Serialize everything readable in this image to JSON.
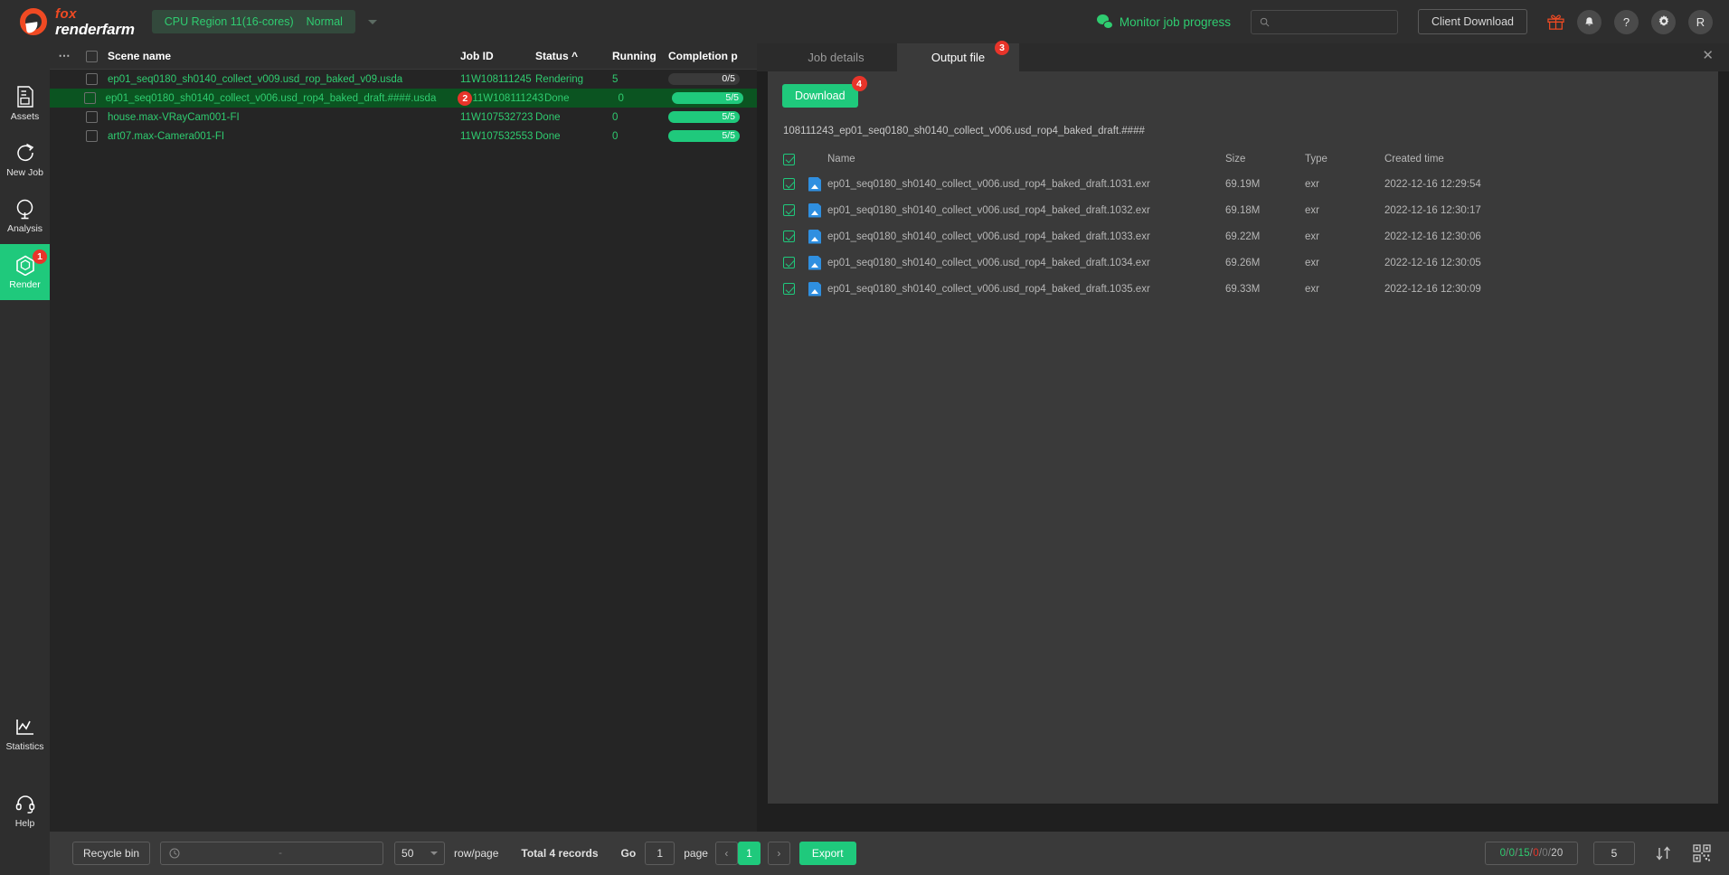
{
  "header": {
    "logo_fox": "fox",
    "logo_renderfarm": "renderfarm",
    "region_label": "CPU Region 11(16-cores)",
    "region_status": "Normal",
    "monitor_label": "Monitor job progress",
    "search_placeholder": "",
    "search_value": "",
    "client_download_label": "Client Download",
    "avatar_initial": "R",
    "help_glyph": "?"
  },
  "sidebar": {
    "items": [
      {
        "label": "Assets",
        "icon": "file-list-icon",
        "badge": ""
      },
      {
        "label": "New Job",
        "icon": "new-job-icon",
        "badge": ""
      },
      {
        "label": "Analysis",
        "icon": "analysis-icon",
        "badge": ""
      },
      {
        "label": "Render",
        "icon": "render-icon",
        "badge": "1"
      },
      {
        "label": "Statistics",
        "icon": "statistics-icon",
        "badge": ""
      },
      {
        "label": "Help",
        "icon": "headset-icon",
        "badge": ""
      }
    ]
  },
  "jobs": {
    "columns": {
      "scene_name": "Scene name",
      "job_id": "Job ID",
      "status": "Status",
      "running": "Running",
      "completion": "Completion p"
    },
    "rows": [
      {
        "scene_name": "ep01_seq0180_sh0140_collect_v009.usd_rop_baked_v09.usda",
        "job_id": "11W108111245",
        "status": "Rendering",
        "running": "5",
        "progress_text": "0/5",
        "progress_percent": 0,
        "badge": "",
        "selected": false
      },
      {
        "scene_name": "ep01_seq0180_sh0140_collect_v006.usd_rop4_baked_draft.####.usda",
        "job_id": "11W108111243",
        "status": "Done",
        "running": "0",
        "progress_text": "5/5",
        "progress_percent": 100,
        "badge": "2",
        "selected": true
      },
      {
        "scene_name": "house.max-VRayCam001-FI",
        "job_id": "11W107532723",
        "status": "Done",
        "running": "0",
        "progress_text": "5/5",
        "progress_percent": 100,
        "badge": "",
        "selected": false
      },
      {
        "scene_name": "art07.max-Camera001-FI",
        "job_id": "11W107532553",
        "status": "Done",
        "running": "0",
        "progress_text": "5/5",
        "progress_percent": 100,
        "badge": "",
        "selected": false
      }
    ]
  },
  "right_panel": {
    "tabs": [
      {
        "label": "Job details",
        "badge": "",
        "active": false
      },
      {
        "label": "Output file",
        "badge": "3",
        "active": true
      }
    ],
    "close_glyph": "✕",
    "download_label": "Download",
    "download_badge": "4",
    "file_path": "108111243_ep01_seq0180_sh0140_collect_v006.usd_rop4_baked_draft.####",
    "file_columns": {
      "name": "Name",
      "size": "Size",
      "type": "Type",
      "created": "Created time"
    },
    "files": [
      {
        "name": "ep01_seq0180_sh0140_collect_v006.usd_rop4_baked_draft.1031.exr",
        "size": "69.19M",
        "type": "exr",
        "created": "2022-12-16 12:29:54"
      },
      {
        "name": "ep01_seq0180_sh0140_collect_v006.usd_rop4_baked_draft.1032.exr",
        "size": "69.18M",
        "type": "exr",
        "created": "2022-12-16 12:30:17"
      },
      {
        "name": "ep01_seq0180_sh0140_collect_v006.usd_rop4_baked_draft.1033.exr",
        "size": "69.22M",
        "type": "exr",
        "created": "2022-12-16 12:30:06"
      },
      {
        "name": "ep01_seq0180_sh0140_collect_v006.usd_rop4_baked_draft.1034.exr",
        "size": "69.26M",
        "type": "exr",
        "created": "2022-12-16 12:30:05"
      },
      {
        "name": "ep01_seq0180_sh0140_collect_v006.usd_rop4_baked_draft.1035.exr",
        "size": "69.33M",
        "type": "exr",
        "created": "2022-12-16 12:30:09"
      }
    ]
  },
  "bottom_bar": {
    "recycle_bin_label": "Recycle bin",
    "search_value": "",
    "search_placeholder": "-",
    "rows_per_page": "50",
    "rows_per_page_label": "row/page",
    "total_records_label": "Total 4 records",
    "go_label": "Go",
    "page_value": "1",
    "page_label": "page",
    "prev_glyph": "‹",
    "current_page": "1",
    "next_glyph": "›",
    "export_label": "Export",
    "status_counts": {
      "a": "0",
      "b": "0",
      "c": "15",
      "d": "0",
      "e": "0",
      "f": "20",
      "sep": "/"
    },
    "node_count": "5"
  },
  "colors": {
    "accent_green": "#1fc97c",
    "text_green": "#2fcc70",
    "badge_red": "#e8342a",
    "brand_orange": "#f04a23",
    "selected_row": "#0b5421"
  }
}
